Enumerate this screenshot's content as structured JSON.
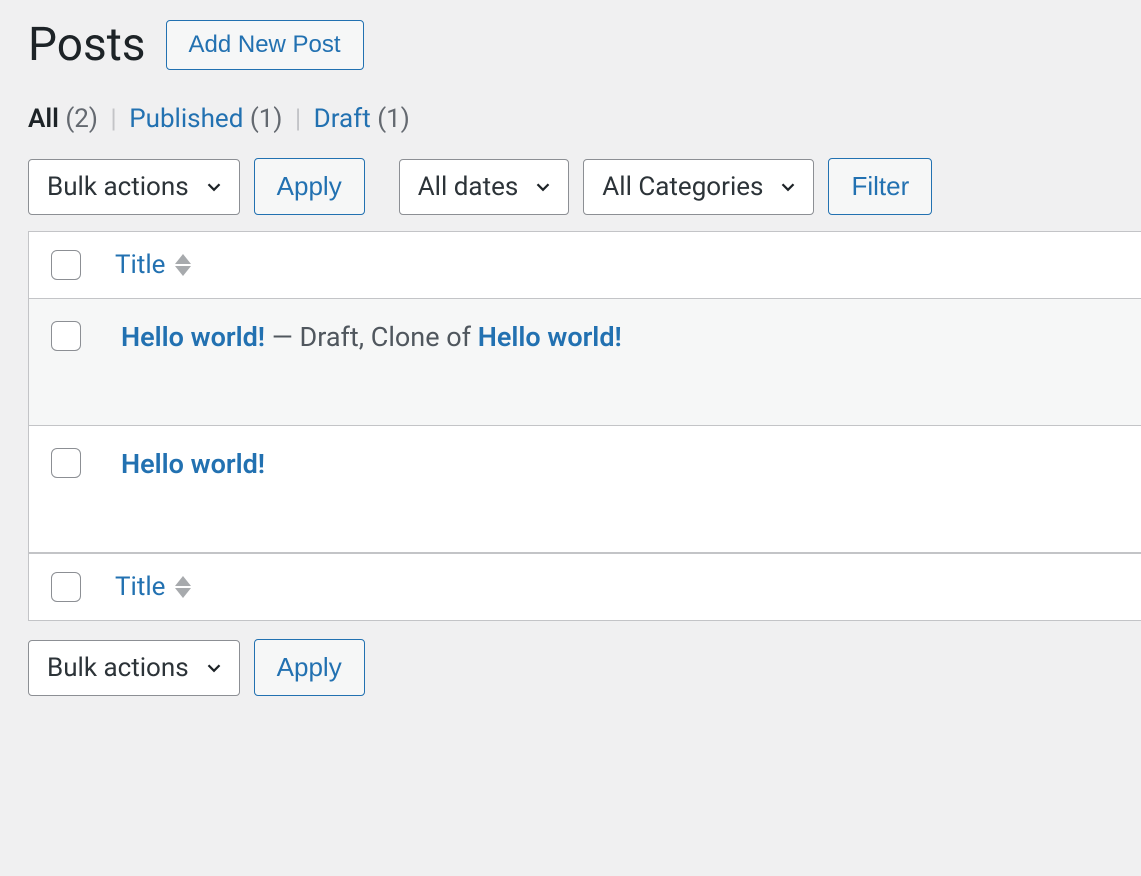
{
  "header": {
    "title": "Posts",
    "add_new_label": "Add New Post"
  },
  "status_filters": {
    "all_label": "All",
    "all_count": "(2)",
    "published_label": "Published",
    "published_count": "(1)",
    "draft_label": "Draft",
    "draft_count": "(1)"
  },
  "toolbar": {
    "bulk_actions_label": "Bulk actions",
    "apply_label": "Apply",
    "dates_label": "All dates",
    "categories_label": "All Categories",
    "filter_label": "Filter"
  },
  "table": {
    "title_col_label": "Title",
    "rows": [
      {
        "title": "Hello world!",
        "suffix_prefix": " — Draft, Clone of ",
        "clone_of": "Hello world!"
      },
      {
        "title": "Hello world!",
        "suffix_prefix": "",
        "clone_of": ""
      }
    ]
  },
  "bottom": {
    "bulk_actions_label": "Bulk actions",
    "apply_label": "Apply"
  }
}
